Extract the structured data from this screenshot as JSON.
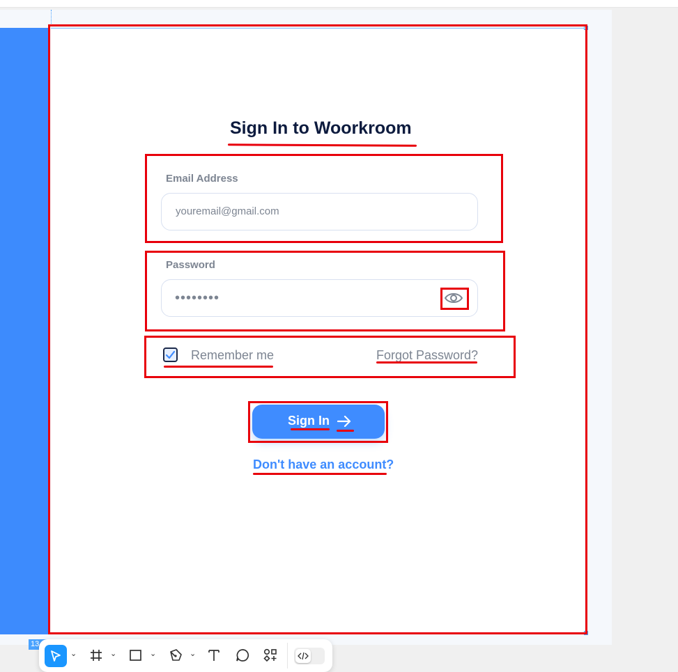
{
  "form": {
    "title": "Sign In to Woorkroom",
    "email": {
      "label": "Email Address",
      "placeholder": "youremail@gmail.com"
    },
    "password": {
      "label": "Password",
      "value": "••••••••",
      "visibility_icon": "eye-icon"
    },
    "remember_me": {
      "label": "Remember me",
      "checked": true
    },
    "forgot_password": "Forgot Password?",
    "submit": {
      "label": "Sign In",
      "icon": "arrow-right-icon"
    },
    "signup_link": "Don't have an account?"
  },
  "canvas": {
    "frame_badge": "13"
  },
  "toolbar": {
    "tools": [
      "move-tool-icon",
      "frame-tool-icon",
      "rectangle-tool-icon",
      "pen-tool-icon",
      "text-tool-icon",
      "comment-tool-icon",
      "components-icon",
      "dev-mode-icon"
    ],
    "active_tool": "move-tool-icon"
  },
  "colors": {
    "accent": "#3f8cff",
    "title": "#0d1b3e",
    "muted": "#7d8592",
    "annotation": "#e8000b",
    "side_panel": "#3d8bfd"
  }
}
